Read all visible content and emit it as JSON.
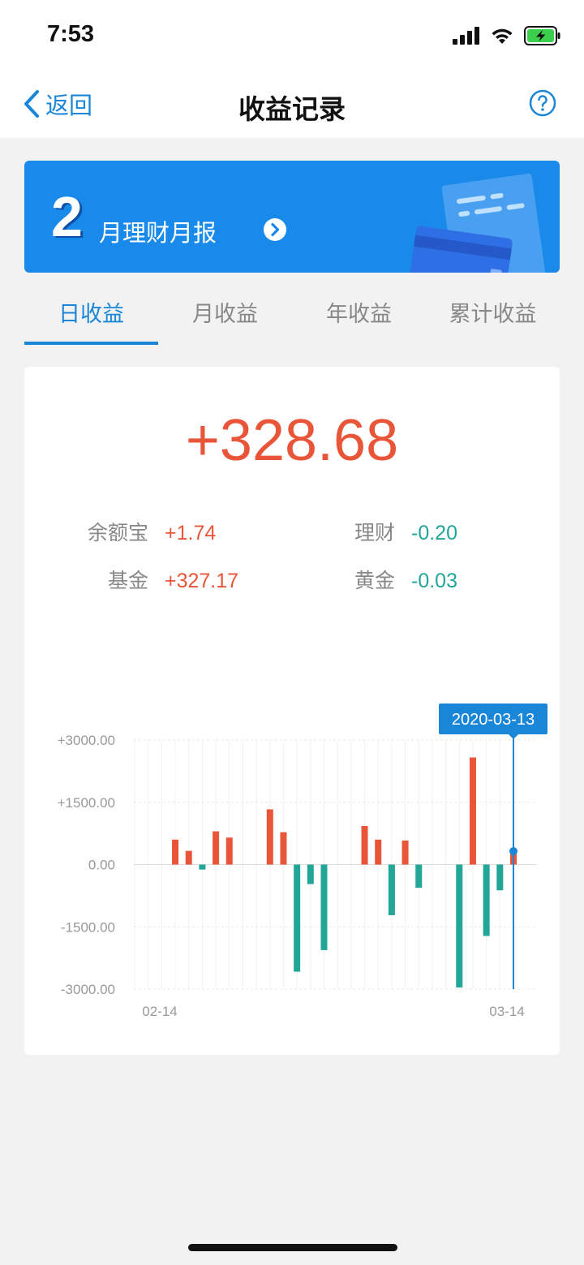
{
  "status_bar": {
    "time": "7:53"
  },
  "nav": {
    "back_label": "返回",
    "title": "收益记录"
  },
  "banner": {
    "month": "2",
    "label": "月理财月报"
  },
  "tabs": [
    {
      "label": "日收益",
      "active": true
    },
    {
      "label": "月收益",
      "active": false
    },
    {
      "label": "年收益",
      "active": false
    },
    {
      "label": "累计收益",
      "active": false
    }
  ],
  "summary": {
    "total": "+328.68",
    "items": [
      {
        "label": "余额宝",
        "value": "+1.74"
      },
      {
        "label": "理财",
        "value": "-0.20"
      },
      {
        "label": "基金",
        "value": "+327.17"
      },
      {
        "label": "黄金",
        "value": "-0.03"
      }
    ]
  },
  "colors": {
    "accent": "#1a86d8",
    "positive": "#e95538",
    "negative": "#22a698",
    "banner": "#1a8aea"
  },
  "chart_data": {
    "type": "bar",
    "y_tick_labels": [
      "+3000.00",
      "+1500.00",
      "0.00",
      "-1500.00",
      "-3000.00"
    ],
    "ylim": [
      -3000,
      3000
    ],
    "x_tick_labels": [
      "02-14",
      "03-14"
    ],
    "x": [
      "02-14",
      "02-15",
      "02-16",
      "02-17",
      "02-18",
      "02-19",
      "02-20",
      "02-21",
      "02-22",
      "02-23",
      "02-24",
      "02-25",
      "02-26",
      "02-27",
      "02-28",
      "02-29",
      "03-01",
      "03-02",
      "03-03",
      "03-04",
      "03-05",
      "03-06",
      "03-07",
      "03-08",
      "03-09",
      "03-10",
      "03-11",
      "03-12",
      "03-13"
    ],
    "values": [
      0,
      0,
      0,
      600,
      330,
      -120,
      800,
      650,
      0,
      0,
      1330,
      780,
      -2580,
      -470,
      -2060,
      0,
      0,
      930,
      600,
      -1220,
      580,
      -560,
      0,
      0,
      -2960,
      2580,
      -1720,
      -620,
      328.68
    ],
    "selected": {
      "date": "2020-03-13",
      "index": 28
    },
    "grid": true
  }
}
